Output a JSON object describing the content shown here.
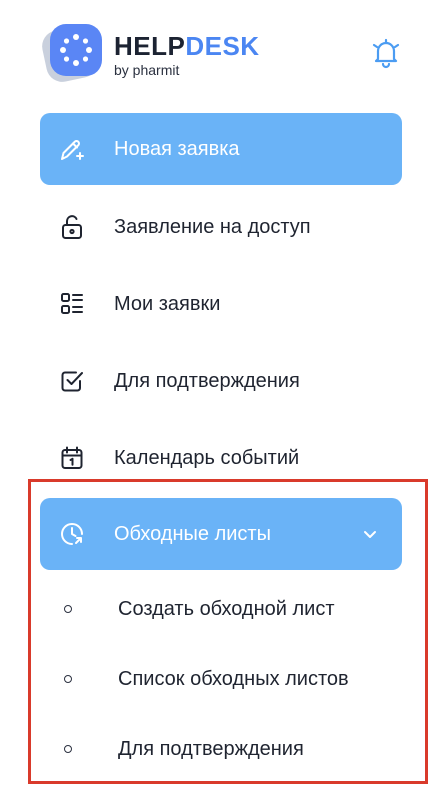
{
  "brand": {
    "name_part1": "HELP",
    "name_part2": "DESK",
    "subtitle": "by pharmit"
  },
  "colors": {
    "accent": "#6ab3f7",
    "brand_blue": "#4b86f2",
    "highlight": "#d93a2b",
    "text": "#1f2430"
  },
  "menu": {
    "items": [
      {
        "label": "Новая заявка",
        "icon": "pencil-plus-icon",
        "active": true
      },
      {
        "label": "Заявление на доступ",
        "icon": "unlock-icon",
        "active": false
      },
      {
        "label": "Мои заявки",
        "icon": "list-icon",
        "active": false
      },
      {
        "label": "Для подтверждения",
        "icon": "checkbox-icon",
        "active": false
      },
      {
        "label": "Календарь событий",
        "icon": "calendar-icon",
        "active": false
      },
      {
        "label": "Обходные листы",
        "icon": "clock-arrow-icon",
        "active": true,
        "expanded": true
      }
    ],
    "subitems": [
      {
        "label": "Создать обходной лист"
      },
      {
        "label": "Список обходных листов"
      },
      {
        "label": "Для подтверждения"
      }
    ]
  }
}
